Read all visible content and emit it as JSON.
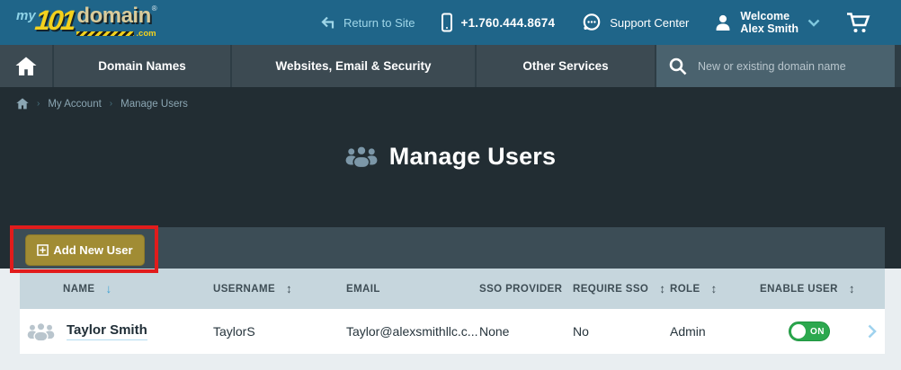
{
  "brand": {
    "my": "my",
    "num": "101",
    "word": "domain",
    "tld": ".com",
    "reg": "®"
  },
  "topbar": {
    "return_to_site": "Return to Site",
    "phone": "+1.760.444.8674",
    "support_center": "Support Center",
    "welcome_line1": "Welcome",
    "welcome_line2": "Alex Smith"
  },
  "nav": {
    "items": [
      "Domain Names",
      "Websites, Email & Security",
      "Other Services"
    ],
    "search_placeholder": "New or existing domain name"
  },
  "breadcrumb": {
    "my_account": "My Account",
    "manage_users": "Manage Users"
  },
  "page": {
    "title": "Manage Users"
  },
  "toolbar": {
    "add_new_user": "Add New User"
  },
  "table": {
    "columns": [
      {
        "label": "NAME",
        "sort": "↓"
      },
      {
        "label": "USERNAME",
        "sort": "↕"
      },
      {
        "label": "EMAIL",
        "sort": ""
      },
      {
        "label": "SSO PROVIDER",
        "sort": ""
      },
      {
        "label": "REQUIRE SSO",
        "sort": "↕"
      },
      {
        "label": "ROLE",
        "sort": "↕"
      },
      {
        "label": "ENABLE USER",
        "sort": "↕"
      }
    ],
    "rows": [
      {
        "name": "Taylor Smith",
        "username": "TaylorS",
        "email": "Taylor@alexsmithllc.c...",
        "sso_provider": "None",
        "require_sso": "No",
        "role": "Admin",
        "enable_state": "ON"
      }
    ]
  },
  "colors": {
    "header_teal": "#1f6589",
    "nav_dark": "#3c4a52",
    "page_dark": "#222d33",
    "toolbar_slate": "#3c4d56",
    "button_gold": "#a18c34",
    "highlight_red": "#e11c1c",
    "table_header_blue": "#c6d6dd",
    "toggle_green": "#2ca84e",
    "sort_active_blue": "#3aa0d3"
  }
}
